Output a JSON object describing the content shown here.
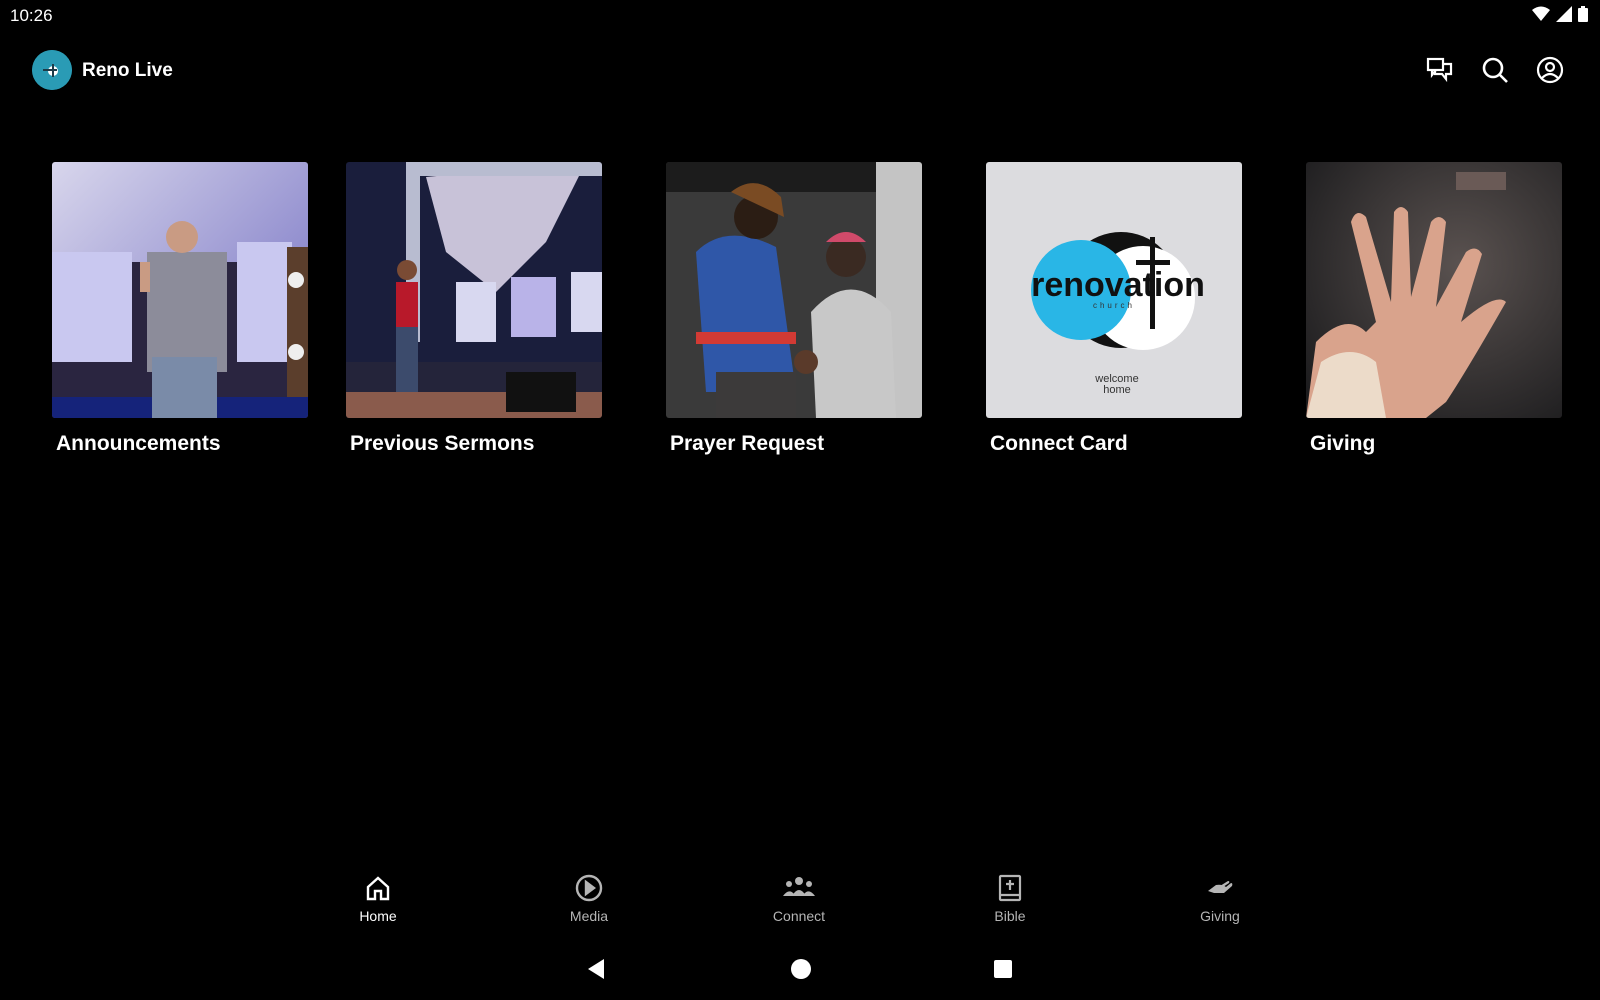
{
  "status_bar": {
    "time": "10:26",
    "icons": [
      "wifi-icon",
      "cellular-signal-icon",
      "battery-icon"
    ]
  },
  "app_bar": {
    "title": "Reno Live",
    "logo": "church-logo",
    "actions": [
      "chat-icon",
      "search-icon",
      "account-icon"
    ]
  },
  "tiles": [
    {
      "label": "Announcements",
      "image": "pastor speaking on stage with microphone"
    },
    {
      "label": "Previous Sermons",
      "image": "preacher in red shirt on stage"
    },
    {
      "label": "Prayer Request",
      "image": "two people praying together"
    },
    {
      "label": "Connect Card",
      "image": "renovation church logo",
      "logo_text": "renovation",
      "logo_sub": "church",
      "logo_tag1": "welcome",
      "logo_tag2": "home"
    },
    {
      "label": "Giving",
      "image": "open hand"
    }
  ],
  "bottom_nav": {
    "items": [
      {
        "label": "Home",
        "icon": "home-icon",
        "active": true
      },
      {
        "label": "Media",
        "icon": "play-circle-icon",
        "active": false
      },
      {
        "label": "Connect",
        "icon": "group-icon",
        "active": false
      },
      {
        "label": "Bible",
        "icon": "bible-icon",
        "active": false
      },
      {
        "label": "Giving",
        "icon": "giving-hand-icon",
        "active": false
      }
    ]
  },
  "system_nav": [
    "back-icon",
    "home-circle-icon",
    "recents-icon"
  ],
  "colors": {
    "background": "#000000",
    "logo_bg": "#2a9bb5",
    "accent_blue": "#29b6e6",
    "inactive_nav": "#b5b5b5"
  }
}
